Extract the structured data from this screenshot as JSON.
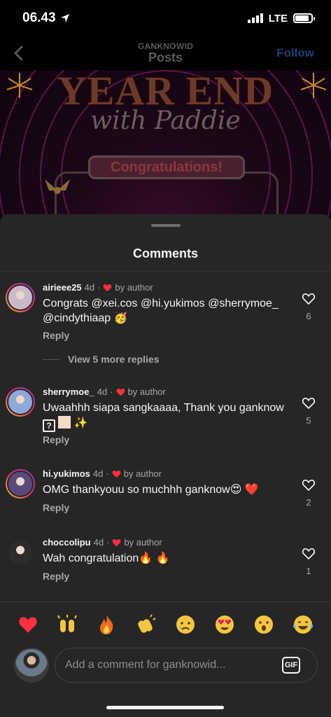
{
  "status_bar": {
    "time": "06.43",
    "network": "LTE",
    "battery_level": 0.85
  },
  "header": {
    "username": "GANKNOWID",
    "title": "Posts",
    "follow_label": "Follow"
  },
  "banner": {
    "title": "YEAR END",
    "subtitle": "with Paddie",
    "pill": "Congratulations!"
  },
  "sheet": {
    "title": "Comments"
  },
  "comments": [
    {
      "username": "airieee25",
      "time": "4d",
      "by_author": "by author",
      "text": "Congrats @xei.cos @hi.yukimos @sherrymoe_ @cindythiaap 🥳",
      "reply": "Reply",
      "likes": "6",
      "avatar_color": "#c9b9c9"
    },
    {
      "username": "sherrymoe_",
      "time": "4d",
      "by_author": "by author",
      "text_a": "Uwaahhh siapa sangkaaaa, Thank you ganknow",
      "text_q": "?",
      "text_b": "✨",
      "reply": "Reply",
      "likes": "5",
      "avatar_color": "#8fa8d8"
    },
    {
      "username": "hi.yukimos",
      "time": "4d",
      "by_author": "by author",
      "text": "OMG thankyouu so muchhh ganknow😍 ❤️",
      "reply": "Reply",
      "likes": "2",
      "avatar_color": "#5a4a7a"
    },
    {
      "username": "choccolipu",
      "time": "4d",
      "by_author": "by author",
      "text": "Wah congratulation🔥 🔥",
      "reply": "Reply",
      "likes": "1",
      "avatar_color": "#2c2c2c"
    }
  ],
  "view_more": "View 5 more replies",
  "reactions": [
    "❤️",
    "🙌",
    "🔥",
    "👏",
    "😢",
    "😍",
    "😮",
    "😂"
  ],
  "input": {
    "placeholder": "Add a comment for ganknowid...",
    "gif_label": "GIF"
  },
  "colors": {
    "sheet_bg": "#262626",
    "heart_red": "#ff3040",
    "muted": "#a8a8a8"
  }
}
